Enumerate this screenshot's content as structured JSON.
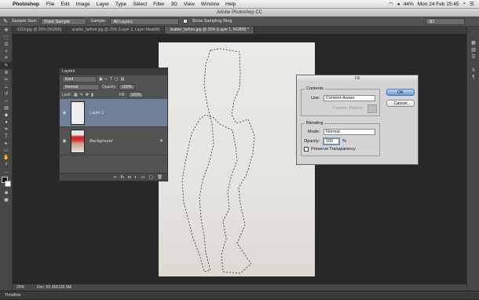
{
  "menubar": {
    "app": "Photoshop",
    "items": [
      "File",
      "Edit",
      "Image",
      "Layer",
      "Type",
      "Select",
      "Filter",
      "3D",
      "View",
      "Window",
      "Help"
    ],
    "battery": "44%",
    "datetime": "Mon 24 Feb 15:45"
  },
  "window_title": "Adobe Photoshop CC",
  "options": {
    "sample_size_label": "Sample Size:",
    "sample_size_value": "Point Sample",
    "sample_label": "Sample:",
    "sample_value": "All Layers",
    "show_ring_label": "Show Sampling Ring",
    "workspace": "3D"
  },
  "tabs": [
    {
      "label": "6119.jpg @ 25% (RGB/8)"
    },
    {
      "label": "scatter_before.jpg @ 25% (Layer 2, Layer Mask/8)"
    },
    {
      "label": "scatter_before.jpg @ 25% (Layer 1, RGB/8) *"
    }
  ],
  "layers": {
    "title": "Layers",
    "filter": "Kind",
    "blend": "Normal",
    "opacity_label": "Opacity:",
    "opacity_value": "100%",
    "lock_label": "Lock:",
    "fill_label": "Fill:",
    "fill_value": "100%",
    "items": [
      {
        "name": "Layer 1"
      },
      {
        "name": "Background"
      }
    ]
  },
  "fill_dialog": {
    "title": "Fill",
    "contents_label": "Contents",
    "use_label": "Use:",
    "use_value": "Content-Aware",
    "custom_pattern_label": "Custom Pattern:",
    "blending_label": "Blending",
    "mode_label": "Mode:",
    "mode_value": "Normal",
    "opacity_label": "Opacity:",
    "opacity_value": "100",
    "opacity_unit": "%",
    "preserve_label": "Preserve Transparency",
    "ok_label": "OK",
    "cancel_label": "Cancel"
  },
  "status": {
    "zoom": "25%",
    "doc": "Doc: 60.2M/120.3M"
  },
  "timeline_label": "Timeline"
}
